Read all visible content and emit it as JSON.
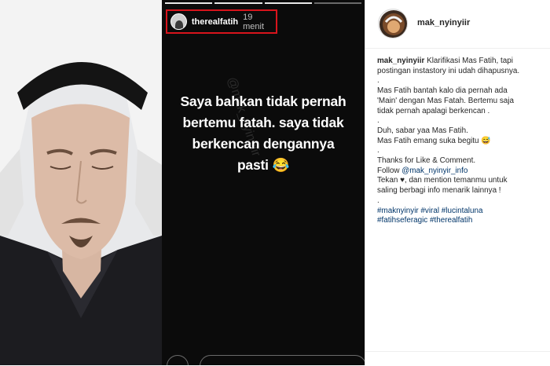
{
  "story": {
    "username": "therealfatih",
    "time": "19 menit",
    "watermark": "@mak_nyinyiir",
    "caption_lines": [
      "Saya bahkan tidak pernah",
      "bertemu fatah. saya tidak",
      "berkencan dengannya",
      "pasti 😂"
    ]
  },
  "post": {
    "username": "mak_nyinyiir",
    "caption": {
      "author": "mak_nyinyiir",
      "line1_rest": " Klarifikasi Mas Fatih, tapi",
      "line2": "postingan instastory ini udah dihapusnya.",
      "dot1": ".",
      "para2a": "Mas Fatih bantah kalo dia pernah ada",
      "para2b": "'Main' dengan Mas Fatah. Bertemu saja",
      "para2c": "tidak pernah apalagi berkencan .",
      "dot2": ".",
      "para3a": "Duh, sabar yaa Mas Fatih.",
      "para3b": "Mas Fatih emang suka begitu 😅",
      "dot3": ".",
      "para4a": "Thanks for Like & Comment.",
      "follow_prefix": "Follow ",
      "follow_link": "@mak_nyinyir_info",
      "para4c": "Tekan ♥, dan mention temanmu untuk",
      "para4d": "saling berbagi info menarik lainnya !",
      "dot4": ".",
      "hashtags_line1": "#maknyinyir #viral #lucintaluna",
      "hashtags_line2": "#fatihseferagic #therealfatih"
    }
  }
}
